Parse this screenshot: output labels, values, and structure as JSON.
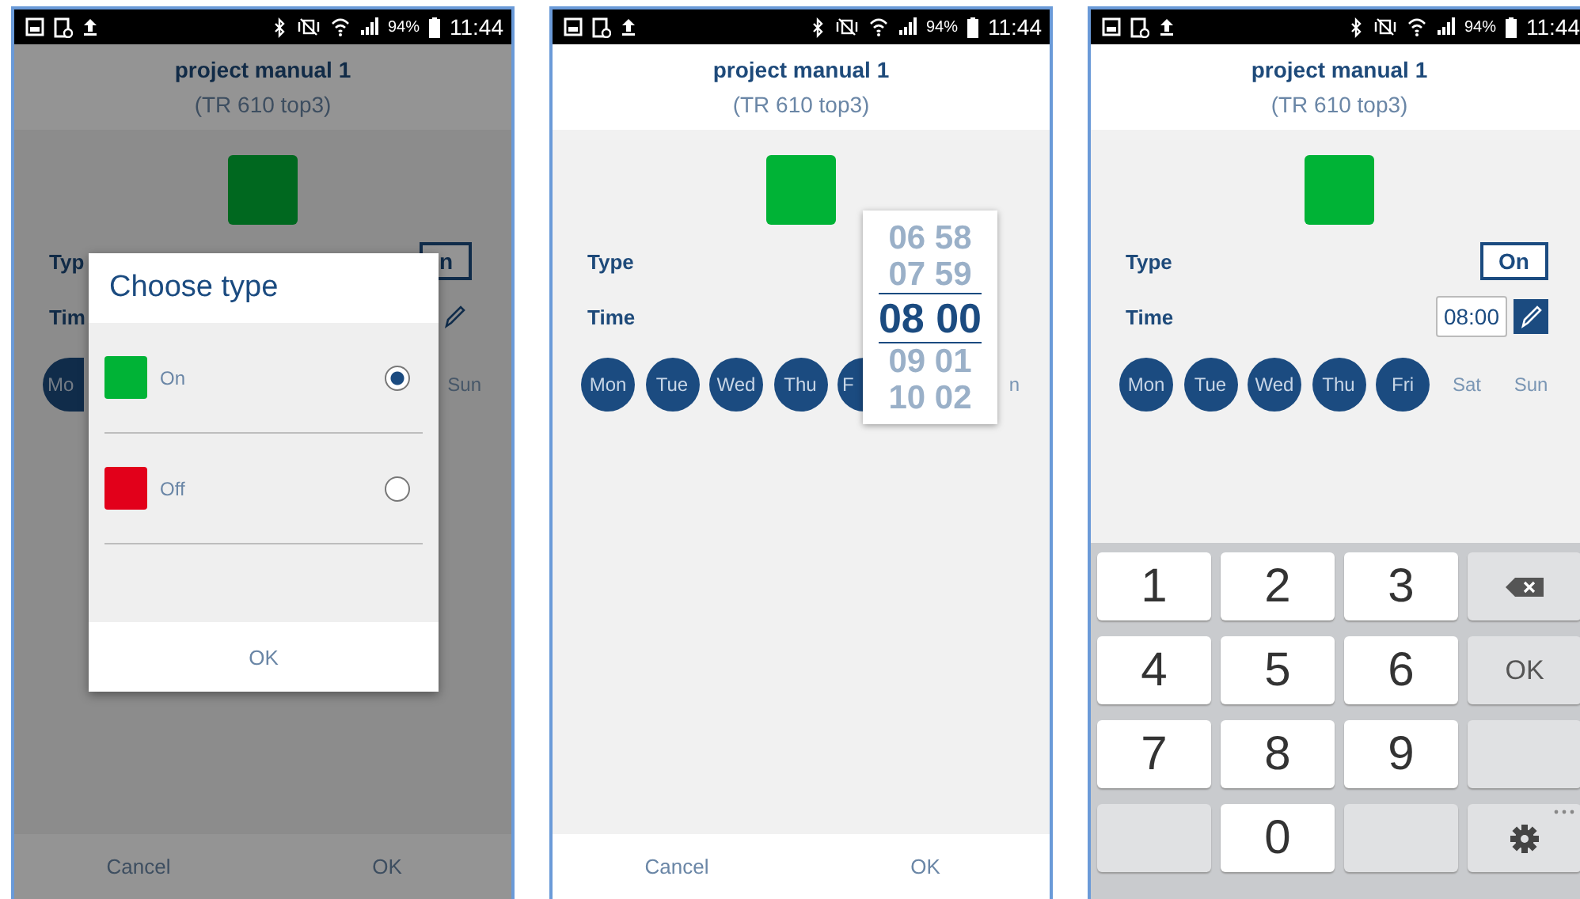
{
  "screens": [
    {
      "status_bar": {
        "battery": "94%",
        "time": "11:44"
      },
      "header": {
        "title": "project manual 1",
        "subtitle": "(TR 610 top3)"
      },
      "dimmed": true,
      "type_row": {
        "label": "Typ",
        "value": "n"
      },
      "time_row": {
        "label": "Tim",
        "edit_active": false
      },
      "days": [
        {
          "label": "Mo",
          "selected": true,
          "kind": "partial"
        },
        {
          "label": "Sun",
          "selected": false,
          "kind": "full"
        }
      ],
      "dialog": {
        "title": "Choose type",
        "options": [
          {
            "label": "On",
            "color": "#00b336",
            "selected": true
          },
          {
            "label": "Off",
            "color": "#e2001a",
            "selected": false
          }
        ],
        "button": "OK"
      },
      "footer": {
        "buttons": [
          "Cancel",
          "OK"
        ]
      }
    },
    {
      "status_bar": {
        "battery": "94%",
        "time": "11:44"
      },
      "header": {
        "title": "project manual 1",
        "subtitle": "(TR 610 top3)"
      },
      "dimmed": false,
      "type_row": {
        "label": "Type"
      },
      "time_row": {
        "label": "Time"
      },
      "days": [
        {
          "label": "Mon",
          "selected": true,
          "kind": "full"
        },
        {
          "label": "Tue",
          "selected": true,
          "kind": "full"
        },
        {
          "label": "Wed",
          "selected": true,
          "kind": "full"
        },
        {
          "label": "Thu",
          "selected": true,
          "kind": "full"
        },
        {
          "label": "F",
          "selected": true,
          "kind": "partial"
        },
        {
          "label": "n",
          "selected": false,
          "kind": "full"
        }
      ],
      "picker": {
        "rows": [
          {
            "text": "06 58",
            "selected": false
          },
          {
            "text": "07 59",
            "selected": false
          },
          {
            "text": "08 00",
            "selected": true
          },
          {
            "text": "09 01",
            "selected": false
          },
          {
            "text": "10 02",
            "selected": false
          }
        ]
      },
      "footer": {
        "buttons": [
          "Cancel",
          "OK"
        ]
      }
    },
    {
      "status_bar": {
        "battery": "94%",
        "time": "11:44"
      },
      "header": {
        "title": "project manual 1",
        "subtitle": "(TR 610 top3)"
      },
      "dimmed": false,
      "type_row": {
        "label": "Type",
        "value": "On"
      },
      "time_row": {
        "label": "Time",
        "value": "08:00",
        "edit_active": true
      },
      "days": [
        {
          "label": "Mon",
          "selected": true,
          "kind": "full"
        },
        {
          "label": "Tue",
          "selected": true,
          "kind": "full"
        },
        {
          "label": "Wed",
          "selected": true,
          "kind": "full"
        },
        {
          "label": "Thu",
          "selected": true,
          "kind": "full"
        },
        {
          "label": "Fri",
          "selected": true,
          "kind": "full"
        },
        {
          "label": "Sat",
          "selected": false,
          "kind": "full"
        },
        {
          "label": "Sun",
          "selected": false,
          "kind": "full"
        }
      ],
      "keyboard": {
        "keys": [
          {
            "kind": "digit",
            "label": "1"
          },
          {
            "kind": "digit",
            "label": "2"
          },
          {
            "kind": "digit",
            "label": "3"
          },
          {
            "kind": "backspace"
          },
          {
            "kind": "digit",
            "label": "4"
          },
          {
            "kind": "digit",
            "label": "5"
          },
          {
            "kind": "digit",
            "label": "6"
          },
          {
            "kind": "action",
            "label": "OK"
          },
          {
            "kind": "digit",
            "label": "7"
          },
          {
            "kind": "digit",
            "label": "8"
          },
          {
            "kind": "digit",
            "label": "9"
          },
          {
            "kind": "blank"
          },
          {
            "kind": "blank"
          },
          {
            "kind": "digit",
            "label": "0"
          },
          {
            "kind": "blank"
          },
          {
            "kind": "settings"
          }
        ]
      }
    }
  ]
}
